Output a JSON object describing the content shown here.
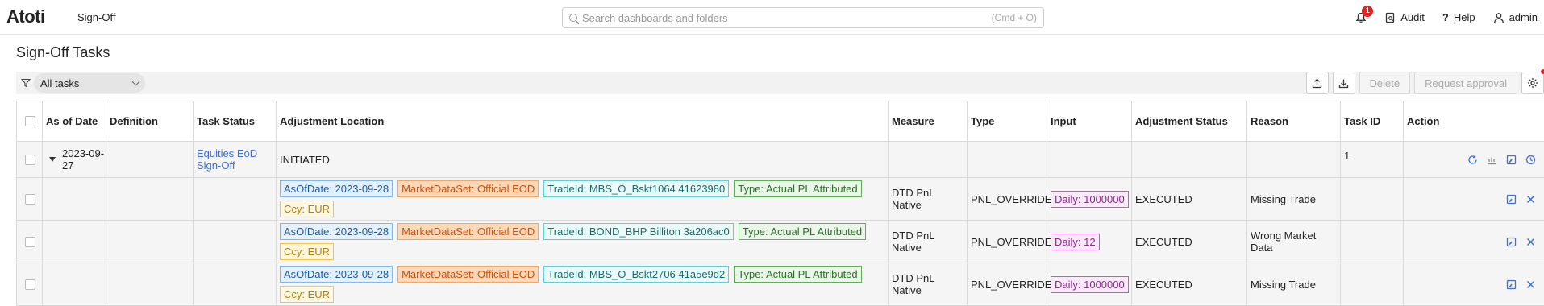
{
  "header": {
    "logo": "Atoti",
    "app_name": "Sign-Off",
    "search_placeholder": "Search dashboards and folders",
    "search_shortcut": "(Cmd + O)",
    "notification_count": "1",
    "audit_label": "Audit",
    "help_label": "Help",
    "user_label": "admin"
  },
  "page": {
    "title": "Sign-Off Tasks"
  },
  "toolbar": {
    "filter_value": "All tasks",
    "delete_label": "Delete",
    "request_approval_label": "Request approval"
  },
  "table": {
    "columns": {
      "as_of_date": "As of Date",
      "definition": "Definition",
      "task_status": "Task Status",
      "adjustment_location": "Adjustment Location",
      "measure": "Measure",
      "type": "Type",
      "input": "Input",
      "adjustment_status": "Adjustment Status",
      "reason": "Reason",
      "task_id": "Task ID",
      "action": "Action"
    },
    "group": {
      "as_of_date": "2023-09-27",
      "definition": "Equities EoD Sign-Off",
      "task_status": "INITIATED",
      "task_id": "1"
    },
    "rows": [
      {
        "tags": [
          "AsOfDate: 2023-09-28",
          "MarketDataSet: Official EOD",
          "TradeId: MBS_O_Bskt1064 41623980",
          "Type: Actual PL Attributed",
          "Ccy: EUR"
        ],
        "measure": "DTD PnL Native",
        "type": "PNL_OVERRIDE",
        "input": "Daily: 1000000",
        "adjustment_status": "EXECUTED",
        "reason": "Missing Trade"
      },
      {
        "tags": [
          "AsOfDate: 2023-09-28",
          "MarketDataSet: Official EOD",
          "TradeId: BOND_BHP Billiton 3a206ac0",
          "Type: Actual PL Attributed",
          "Ccy: EUR"
        ],
        "measure": "DTD PnL Native",
        "type": "PNL_OVERRIDE",
        "input": "Daily: 12",
        "adjustment_status": "EXECUTED",
        "reason": "Wrong Market Data"
      },
      {
        "tags": [
          "AsOfDate: 2023-09-28",
          "MarketDataSet: Official EOD",
          "TradeId: MBS_O_Bskt2706 41a5e9d2",
          "Type: Actual PL Attributed",
          "Ccy: EUR"
        ],
        "measure": "DTD PnL Native",
        "type": "PNL_OVERRIDE",
        "input": "Daily: 1000000",
        "adjustment_status": "EXECUTED",
        "reason": "Missing Trade"
      }
    ]
  },
  "colors": {
    "accent": "#3d6fd6",
    "badge": "#e02424",
    "tag_blue": "#e4f1fc",
    "tag_orange": "#ffd8b8",
    "tag_cyan": "#eafafa",
    "tag_green": "#eaf7e8",
    "tag_yellow": "#fff8e0",
    "tag_purple": "#fbe8fb"
  }
}
